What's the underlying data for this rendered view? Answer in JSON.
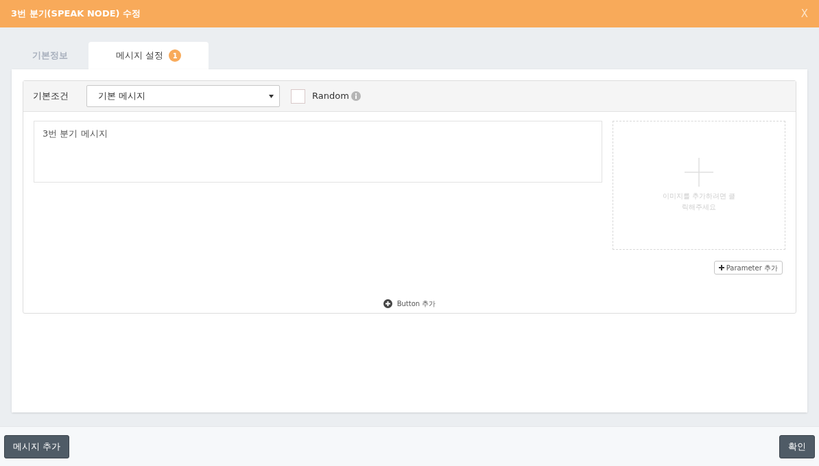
{
  "window": {
    "title": "3번 분기(SPEAK NODE) 수정",
    "close": "X"
  },
  "tabs": [
    {
      "label": "기본정보",
      "selected": false
    },
    {
      "label": "메시지 설정",
      "selected": true,
      "badge": "1"
    }
  ],
  "condition": {
    "label": "기본조건",
    "value": "기본 메시지"
  },
  "random": {
    "label": "Random",
    "checked": false
  },
  "message": {
    "value": "3번 분기 메시지"
  },
  "image_drop": {
    "hint": "이미지를 추가하려면 클릭해주세요"
  },
  "parameter_button": "Parameter 추가",
  "add_button": "Button 추가",
  "footer": {
    "left_button": "메시지 추가",
    "right_button": "확인"
  }
}
